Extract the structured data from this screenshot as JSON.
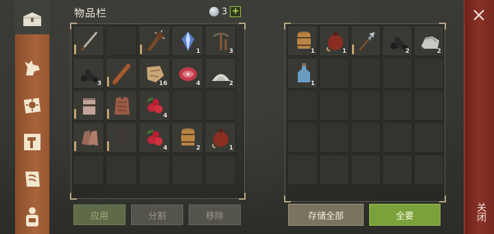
{
  "title": "物品栏",
  "currency": {
    "amount": "3",
    "plus": "+"
  },
  "tabs": [
    {
      "name": "storage-chest-tab",
      "icon": "chest-icon",
      "active": true
    },
    {
      "name": "dog-tab",
      "icon": "dog-icon"
    },
    {
      "name": "map-tab",
      "icon": "sun-map-icon"
    },
    {
      "name": "crafting-tab",
      "icon": "hammer-icon"
    },
    {
      "name": "quest-tab",
      "icon": "scroll-icon"
    },
    {
      "name": "character-tab",
      "icon": "backpack-icon"
    }
  ],
  "inventory": {
    "rows": [
      [
        {
          "icon": "sword-icon",
          "qty": "",
          "dura": true
        },
        {
          "icon": "",
          "qty": ""
        },
        {
          "icon": "spiked-club-icon",
          "qty": "",
          "dura": true
        },
        {
          "icon": "crystal-icon",
          "qty": "1"
        },
        {
          "icon": "pickaxe-icon",
          "qty": "3"
        }
      ],
      [
        {
          "icon": "coal-icon",
          "qty": "3"
        },
        {
          "icon": "wooden-club-icon",
          "qty": "",
          "dura": true
        },
        {
          "icon": "leather-scraps-icon",
          "qty": "16"
        },
        {
          "icon": "raw-meat-icon",
          "qty": "4"
        },
        {
          "icon": "salt-pile-icon",
          "qty": "2"
        }
      ],
      [
        {
          "icon": "helmet-icon",
          "qty": "",
          "dura": true
        },
        {
          "icon": "leather-armor-icon",
          "qty": "",
          "dura": true
        },
        {
          "icon": "berries-icon",
          "qty": "4"
        },
        {
          "icon": "",
          "qty": ""
        },
        {
          "icon": "",
          "qty": ""
        }
      ],
      [
        {
          "icon": "gloves-icon",
          "qty": "",
          "dura": true
        },
        {
          "icon": "pants-icon",
          "qty": "",
          "dura": true
        },
        {
          "icon": "berries-icon",
          "qty": "4"
        },
        {
          "icon": "barrel-icon",
          "qty": "2"
        },
        {
          "icon": "waterskin-icon",
          "qty": "1"
        }
      ],
      [
        {
          "icon": "",
          "qty": ""
        },
        {
          "icon": "",
          "qty": ""
        },
        {
          "icon": "",
          "qty": ""
        },
        {
          "icon": "",
          "qty": ""
        },
        {
          "icon": "",
          "qty": ""
        }
      ]
    ]
  },
  "storage": {
    "rows": [
      [
        {
          "icon": "barrel-icon",
          "qty": "1"
        },
        {
          "icon": "waterskin-icon",
          "qty": "1"
        },
        {
          "icon": "halberd-icon",
          "qty": "",
          "dura": true
        },
        {
          "icon": "coal-icon",
          "qty": "2"
        },
        {
          "icon": "stone-icon",
          "qty": "2"
        }
      ],
      [
        {
          "icon": "bottle-icon",
          "qty": "1"
        },
        {
          "icon": "",
          "qty": ""
        },
        {
          "icon": "",
          "qty": ""
        },
        {
          "icon": "",
          "qty": ""
        },
        {
          "icon": "",
          "qty": ""
        }
      ],
      [
        {
          "icon": "",
          "qty": ""
        },
        {
          "icon": "",
          "qty": ""
        },
        {
          "icon": "",
          "qty": ""
        },
        {
          "icon": "",
          "qty": ""
        },
        {
          "icon": "",
          "qty": ""
        }
      ],
      [
        {
          "icon": "",
          "qty": ""
        },
        {
          "icon": "",
          "qty": ""
        },
        {
          "icon": "",
          "qty": ""
        },
        {
          "icon": "",
          "qty": ""
        },
        {
          "icon": "",
          "qty": ""
        }
      ],
      [
        {
          "icon": "",
          "qty": ""
        },
        {
          "icon": "",
          "qty": ""
        },
        {
          "icon": "",
          "qty": ""
        },
        {
          "icon": "",
          "qty": ""
        },
        {
          "icon": "",
          "qty": ""
        }
      ]
    ]
  },
  "buttons": {
    "apply": "应用",
    "split": "分割",
    "remove": "移除",
    "store_all": "存储全部",
    "take_all": "全要"
  },
  "close": {
    "label": "关闭"
  },
  "colors": {
    "accent_green": "#7aa13a",
    "close_red": "#7e2a22",
    "tab_orange": "#9a5a33"
  }
}
